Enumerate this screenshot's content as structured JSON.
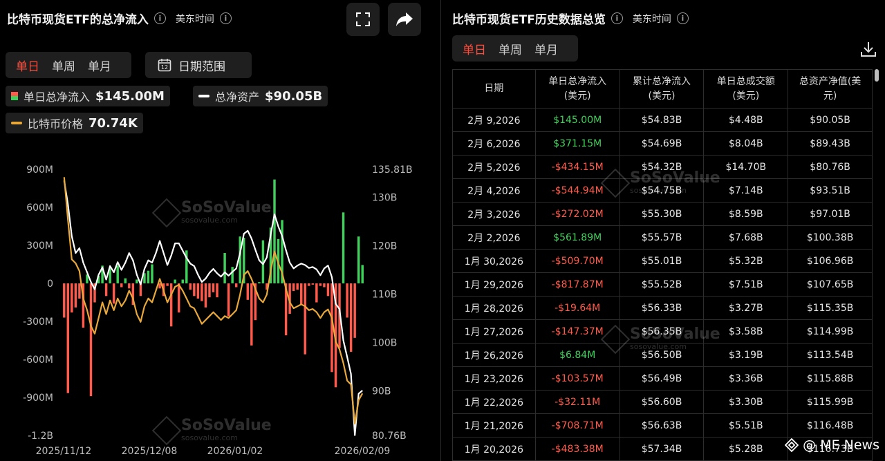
{
  "left": {
    "title": "比特币现货ETF的总净流入",
    "timezone": "美东时间",
    "tabs": [
      "单日",
      "单周",
      "单月"
    ],
    "date_range": "日期范围",
    "calendar_num": "12",
    "legend": {
      "daily_label": "单日总净流入",
      "daily_value": "$145.00M",
      "assets_label": "总净资产",
      "assets_value": "$90.05B",
      "price_label": "比特币价格",
      "price_value": "70.74K"
    }
  },
  "right": {
    "title": "比特币现货ETF历史数据总览",
    "timezone": "美东时间",
    "tabs": [
      "单日",
      "单周",
      "单月"
    ],
    "headers": [
      "日期",
      "单日总净流入\n(美元)",
      "累计总净流入\n(美元)",
      "单日总成交额\n(美元)",
      "总资产净值(美\n元)"
    ],
    "rows": [
      [
        "2月 9,2026",
        "$145.00M",
        "$54.83B",
        "$4.48B",
        "$90.05B"
      ],
      [
        "2月 6,2026",
        "$371.15M",
        "$54.69B",
        "$8.04B",
        "$89.43B"
      ],
      [
        "2月 5,2026",
        "-$434.15M",
        "$54.32B",
        "$14.70B",
        "$80.76B"
      ],
      [
        "2月 4,2026",
        "-$544.94M",
        "$54.75B",
        "$7.14B",
        "$93.51B"
      ],
      [
        "2月 3,2026",
        "-$272.02M",
        "$55.30B",
        "$8.59B",
        "$97.01B"
      ],
      [
        "2月 2,2026",
        "$561.89M",
        "$55.57B",
        "$7.68B",
        "$100.38B"
      ],
      [
        "1月 30,2026",
        "-$509.70M",
        "$55.01B",
        "$5.32B",
        "$106.96B"
      ],
      [
        "1月 29,2026",
        "-$817.87M",
        "$55.52B",
        "$7.51B",
        "$107.65B"
      ],
      [
        "1月 28,2026",
        "-$19.64M",
        "$56.33B",
        "$3.27B",
        "$115.35B"
      ],
      [
        "1月 27,2026",
        "-$147.37M",
        "$56.35B",
        "$3.58B",
        "$114.99B"
      ],
      [
        "1月 26,2026",
        "$6.84M",
        "$56.50B",
        "$3.19B",
        "$113.54B"
      ],
      [
        "1月 23,2026",
        "-$103.57M",
        "$56.49B",
        "$3.36B",
        "$115.88B"
      ],
      [
        "1月 22,2026",
        "-$32.11M",
        "$56.60B",
        "$3.30B",
        "$115.99B"
      ],
      [
        "1月 21,2026",
        "-$708.71M",
        "$56.63B",
        "$5.51B",
        "$116.48B"
      ],
      [
        "1月 20,2026",
        "-$483.38M",
        "$57.34B",
        "$5.28B",
        "$116.73B"
      ]
    ]
  },
  "watermark": {
    "brand": "SoSoValue",
    "sub": "sosovalue.com"
  },
  "footer_brand": "@ ME News",
  "colors": {
    "up": "#3fd15b",
    "down": "#ff5a4b",
    "assets_line": "#ffffff",
    "price_line": "#e8a83a",
    "accent": "#ff4d3d"
  },
  "chart_data": {
    "type": "bar",
    "title": "比特币现货ETF的总净流入",
    "x_ticks": [
      "2025/11/12",
      "2025/12/08",
      "2026/01/02",
      "2026/02/09"
    ],
    "y_left": {
      "ticks": [
        "900M",
        "600M",
        "300M",
        "0",
        "-300M",
        "-600M",
        "-900M",
        "-1.2B"
      ],
      "ylim_millions": [
        -1200,
        900
      ]
    },
    "y_right": {
      "ticks": [
        "135.81B",
        "130B",
        "120B",
        "110B",
        "100B",
        "90B",
        "80.76B"
      ],
      "ylim_billions": [
        80.76,
        135.81
      ]
    },
    "series": [
      {
        "name": "单日总净流入",
        "unit": "M USD",
        "values": [
          -270,
          -866,
          -230,
          -190,
          -120,
          -350,
          70,
          -890,
          -150,
          60,
          140,
          -100,
          120,
          -160,
          140,
          -30,
          40,
          -40,
          -170,
          30,
          -100,
          80,
          100,
          150,
          0,
          -40,
          -100,
          -20,
          -340,
          30,
          -230,
          30,
          260,
          -50,
          -100,
          -120,
          -140,
          -190,
          -110,
          -70,
          -110,
          0,
          240,
          -260,
          130,
          -30,
          370,
          360,
          -130,
          -490,
          -290,
          10,
          340,
          -50,
          440,
          820,
          350,
          500,
          -410,
          -240,
          -60,
          -50,
          -170,
          -560,
          -20,
          -10,
          -150,
          -20,
          -30,
          -100,
          -700,
          -820,
          -510,
          560,
          -270,
          -540,
          -430,
          370,
          145
        ]
      },
      {
        "name": "总净资产",
        "unit": "B USD",
        "values": [
          133.5,
          128.5,
          122,
          118.5,
          119.5,
          116.5,
          114.5,
          112.5,
          111,
          114,
          115.5,
          113,
          115.8,
          114.5,
          116.6,
          115,
          116.5,
          118.5,
          117,
          114,
          112,
          115.2,
          117,
          116.5,
          118.5,
          121,
          118.5,
          116,
          118,
          120.5,
          120.5,
          119,
          117.5,
          116.3,
          115.8,
          114,
          112.5,
          113.2,
          114.4,
          115.2,
          114.3,
          113.6,
          114.5,
          113.8,
          114.6,
          115.3,
          118.5,
          122.5,
          123.1,
          121.5,
          119.2,
          117,
          116.2,
          117.6,
          122.3,
          126.5,
          124,
          122,
          119.1,
          116.5,
          115.3,
          115.9,
          116.3,
          116,
          115.4,
          115.6,
          115.1,
          113.9,
          115.3,
          115.9,
          113.5,
          108,
          106.9,
          100.4,
          97,
          93.5,
          80.8,
          89.4,
          90.05
        ]
      },
      {
        "name": "比特币价格",
        "unit": "K USD",
        "values": [
          126,
          115,
          105,
          104,
          102,
          95,
          92,
          88,
          86,
          90,
          94,
          91,
          94.5,
          92,
          95,
          93,
          94.5,
          97,
          95,
          91,
          89,
          93,
          95,
          94,
          97,
          100,
          97,
          94,
          96,
          98,
          98.5,
          97,
          95,
          93,
          92.5,
          90.5,
          88.5,
          89.5,
          90.5,
          91.5,
          90.5,
          89.5,
          90.5,
          90,
          91,
          92,
          96,
          101,
          102,
          100,
          97.5,
          95,
          94,
          96,
          102,
          107,
          104,
          101.5,
          97.5,
          94,
          92.5,
          93,
          93.5,
          93,
          92,
          92.3,
          91.5,
          90,
          91.5,
          92.2,
          90,
          84,
          82,
          78.5,
          74,
          73,
          63,
          69,
          70.74
        ]
      }
    ]
  }
}
